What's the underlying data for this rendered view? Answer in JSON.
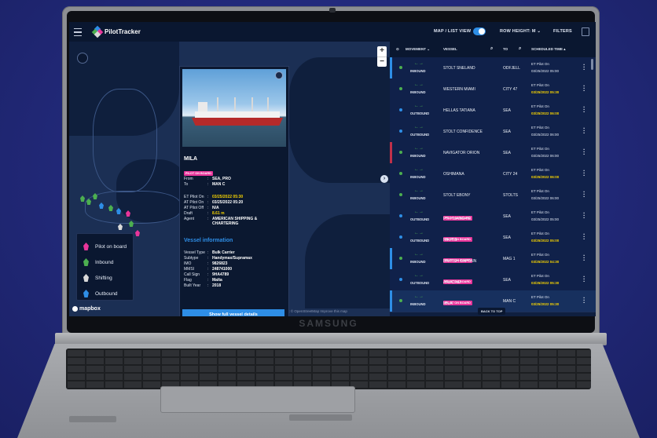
{
  "laptop": {
    "brand": "SAMSUNG"
  },
  "app": {
    "title": "PilotTracker"
  },
  "topbar": {
    "map_list_label": "MAP / LIST VIEW",
    "row_height_label": "ROW HEIGHT: M ⌄",
    "filters_label": "FILTERS"
  },
  "map": {
    "zoom_in": "+",
    "zoom_out": "−",
    "attribution": "© Mapbox © OpenStreetMap  Improve this map",
    "mapbox_label": "mapbox",
    "expand_arrow": "›"
  },
  "legend": {
    "items": [
      {
        "label": "Pilot on board",
        "color": "#e8359a"
      },
      {
        "label": "Inbound",
        "color": "#4caf50"
      },
      {
        "label": "Shifting",
        "color": "#d9d9d9"
      },
      {
        "label": "Outbound",
        "color": "#2e8ee6"
      }
    ]
  },
  "popup": {
    "vessel_name": "MILA",
    "badge": "PILOT ON BOARD",
    "from_label": "From",
    "from_value": "SEA, PRO",
    "to_label": "To",
    "to_value": "MAN C",
    "et_pilot_on_label": "ET Pilot On",
    "et_pilot_on_value": "03/25/2022 05:30",
    "at_pilot_on_label": "AT Pilot On",
    "at_pilot_on_value": "03/25/2022 05:20",
    "at_pilot_off_label": "AT Pilot Off",
    "at_pilot_off_value": "N/A",
    "draft_label": "Draft",
    "draft_value": "8.61 m",
    "agent_label": "Agent",
    "agent_value": "AMERICAN SHIPPING & CHARTERING",
    "section_title": "Vessel information",
    "vessel_type_label": "Vessel Type",
    "vessel_type_value": "Bulk Carrier",
    "subtype_label": "Subtype",
    "subtype_value": "Handymax/Supramax",
    "imo_label": "IMO",
    "imo_value": "9826823",
    "mmsi_label": "MMSI",
    "mmsi_value": "248741000",
    "call_sign_label": "Call Sign",
    "call_sign_value": "9HA4789",
    "flag_label": "Flag",
    "flag_value": "Malta",
    "built_year_label": "Built Year",
    "built_year_value": "2018",
    "button": "Show full vessel details",
    "colon": ":"
  },
  "list": {
    "headers": {
      "movement": "MOVEMENT ⌄",
      "vessel": "VESSEL",
      "to": "TO",
      "scheduled": "SCHEDULED TIME ▴"
    },
    "arrows": "←→",
    "back_to_top": "BACK TO TOP",
    "rows": [
      {
        "movement": "INBOUND",
        "badge": "",
        "vessel": "STOLT SNELAND",
        "to": "ODFJELL",
        "t1": "ET Pilot On",
        "t2": "03/25/2022 05:00",
        "t2_yellow": false,
        "dot": "#4caf50",
        "stripe": "#2e8ee6"
      },
      {
        "movement": "INBOUND",
        "badge": "",
        "vessel": "WESTERN MIAMI",
        "to": "CITY 47",
        "t1": "ET Pilot On",
        "t2": "03/25/2022 05:30",
        "t2_yellow": true,
        "dot": "#4caf50",
        "stripe": ""
      },
      {
        "movement": "OUTBOUND",
        "badge": "",
        "vessel": "HELLAS TATIANA",
        "to": "SEA",
        "t1": "ET Pilot On",
        "t2": "03/25/2022 06:00",
        "t2_yellow": true,
        "dot": "#2e8ee6",
        "stripe": ""
      },
      {
        "movement": "OUTBOUND",
        "badge": "",
        "vessel": "STOLT CONFIDENCE",
        "to": "SEA",
        "t1": "ET Pilot On",
        "t2": "03/25/2022 06:00",
        "t2_yellow": false,
        "dot": "#2e8ee6",
        "stripe": ""
      },
      {
        "movement": "INBOUND",
        "badge": "",
        "vessel": "NAVIGATOR ORION",
        "to": "SEA",
        "t1": "ET Pilot On",
        "t2": "03/25/2022 06:00",
        "t2_yellow": false,
        "dot": "#4caf50",
        "stripe": "#c0304a"
      },
      {
        "movement": "INBOUND",
        "badge": "",
        "vessel": "OSHIMANA",
        "to": "CITY 24",
        "t1": "ET Pilot On",
        "t2": "03/25/2022 06:00",
        "t2_yellow": true,
        "dot": "#4caf50",
        "stripe": ""
      },
      {
        "movement": "INBOUND",
        "badge": "",
        "vessel": "STOLT EBONY",
        "to": "STOLTS",
        "t1": "ET Pilot On",
        "t2": "03/25/2022 06:00",
        "t2_yellow": false,
        "dot": "#4caf50",
        "stripe": ""
      },
      {
        "movement": "OUTBOUND",
        "badge": "PILOT ON BOARD",
        "vessel": "PTI HUANG HE",
        "to": "SEA",
        "t1": "ET Pilot On",
        "t2": "03/25/2022 05:00",
        "t2_yellow": false,
        "dot": "#2e8ee6",
        "stripe": ""
      },
      {
        "movement": "OUTBOUND",
        "badge": "PILOT ON BOARD",
        "vessel": "NIKITIS",
        "to": "SEA",
        "t1": "ET Pilot On",
        "t2": "03/25/2022 05:00",
        "t2_yellow": true,
        "dot": "#2e8ee6",
        "stripe": ""
      },
      {
        "movement": "INBOUND",
        "badge": "PILOT ON BOARD",
        "vessel": "BRITISH CAPTAIN",
        "to": "MAG 1",
        "t1": "ET Pilot On",
        "t2": "03/25/2022 04:30",
        "t2_yellow": true,
        "dot": "#4caf50",
        "stripe": "#2e8ee6"
      },
      {
        "movement": "OUTBOUND",
        "badge": "PILOT ON BOARD",
        "vessel": "ARIADNE",
        "to": "SEA",
        "t1": "ET Pilot On",
        "t2": "03/25/2022 05:30",
        "t2_yellow": true,
        "dot": "#2e8ee6",
        "stripe": ""
      },
      {
        "movement": "INBOUND",
        "badge": "PILOT ON BOARD",
        "vessel": "MILA",
        "to": "MAN C",
        "t1": "ET Pilot On",
        "t2": "03/25/2022 05:30",
        "t2_yellow": true,
        "dot": "#4caf50",
        "stripe": "#2e8ee6",
        "selected": true
      }
    ]
  }
}
